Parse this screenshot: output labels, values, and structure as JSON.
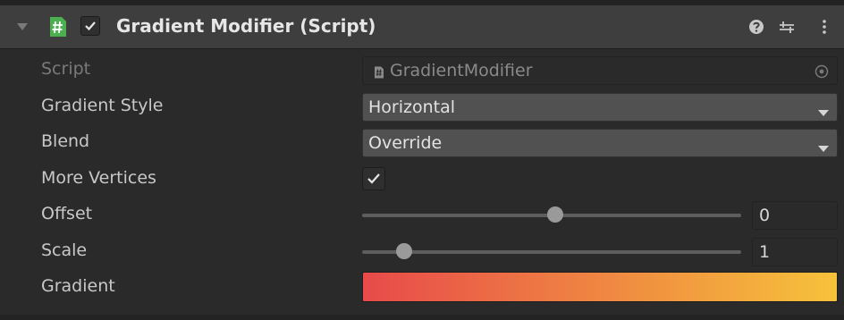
{
  "component": {
    "title": "Gradient Modifier (Script)",
    "enabled": true
  },
  "fields": {
    "script": {
      "label": "Script",
      "value": "GradientModifier"
    },
    "gradient_style": {
      "label": "Gradient Style",
      "value": "Horizontal"
    },
    "blend": {
      "label": "Blend",
      "value": "Override"
    },
    "more_vertices": {
      "label": "More Vertices",
      "checked": true
    },
    "offset": {
      "label": "Offset",
      "value": "0",
      "min": -1,
      "max": 1,
      "position": 0.51
    },
    "scale": {
      "label": "Scale",
      "value": "1",
      "min": 0,
      "max": 10,
      "position": 0.11
    },
    "gradient": {
      "label": "Gradient",
      "start_color": "#e84a4a",
      "end_color": "#f6c23a"
    }
  },
  "colors": {
    "header_bg": "#3e3e3e",
    "panel_bg": "#2a2a2a",
    "script_icon": "#4caf50"
  },
  "icons": {
    "fold": "triangle-down-icon",
    "script": "hash-script-icon",
    "help": "help-icon",
    "preset": "preset-sliders-icon",
    "menu": "kebab-menu-icon",
    "picker": "object-picker-icon",
    "dropdown": "dropdown-arrow-icon"
  }
}
